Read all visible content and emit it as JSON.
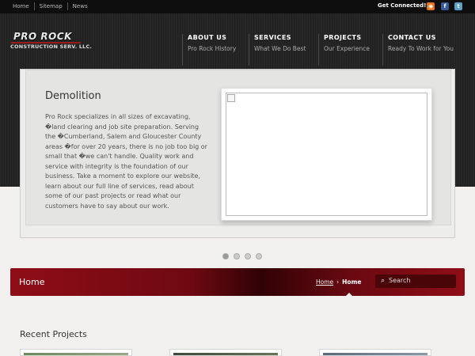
{
  "topbar": {
    "links": [
      "Home",
      "Sitemap",
      "News"
    ],
    "connect_label": "Get Connected!",
    "social": [
      {
        "icon": "rss-icon",
        "glyph": "◉",
        "color": "#e8731d"
      },
      {
        "icon": "facebook-icon",
        "glyph": "f",
        "color": "#3b5998"
      },
      {
        "icon": "twitter-icon",
        "glyph": "t",
        "color": "#5aa0c8"
      }
    ]
  },
  "logo": {
    "line1": "PRO ROCK",
    "line2": "CONSTRUCTION SERV. LLC."
  },
  "nav": [
    {
      "title": "ABOUT US",
      "subtitle": "Pro Rock History"
    },
    {
      "title": "SERVICES",
      "subtitle": "What We Do Best"
    },
    {
      "title": "PROJECTS",
      "subtitle": "Our Experience"
    },
    {
      "title": "CONTACT US",
      "subtitle": "Ready To Work for You"
    }
  ],
  "slide": {
    "title": "Demolition",
    "text": "Pro Rock specializes in all sizes of excavating, �land clearing and job site preparation. Serving the �Cumberland, Salem and Gloucester County areas �for over 20 years, there is no job too big or small that �we can't handle. Quality work and service with integrity is the foundation of our business. Take a moment to explore our website, learn about our full line of services, read about some of our past projects or read what our customers have to say about our work.",
    "dot_count": 4,
    "active_dot": 0
  },
  "page_header": {
    "title": "Home",
    "breadcrumb_home": "Home",
    "breadcrumb_sep": "›",
    "breadcrumb_current": "Home",
    "search_placeholder": "Search"
  },
  "recent": {
    "title": "Recent Projects"
  },
  "colors": {
    "accent_red": "#8f0d17",
    "header_dark": "#232323"
  }
}
